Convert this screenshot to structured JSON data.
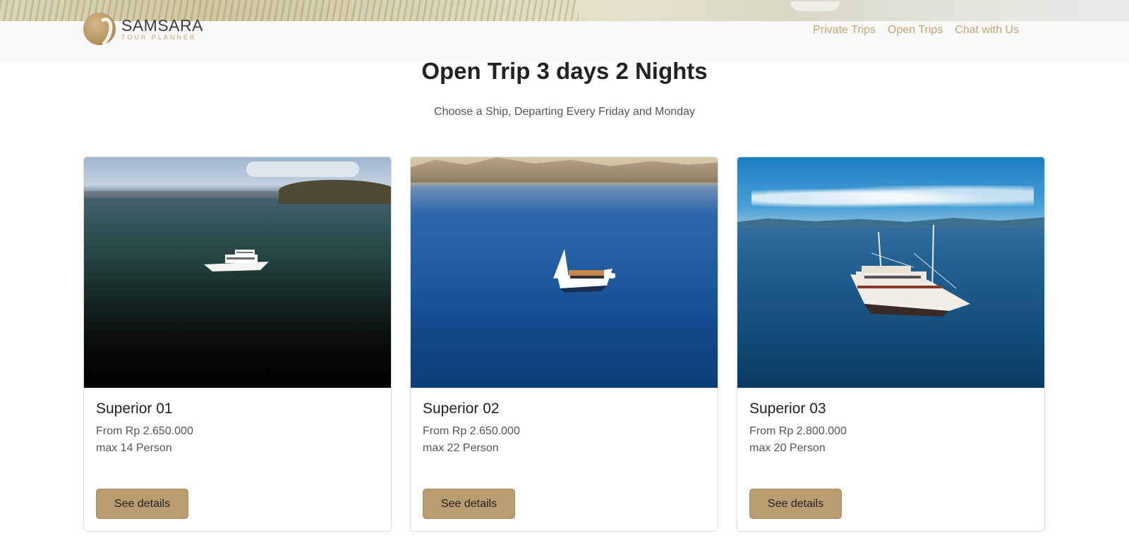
{
  "nav": {
    "brand_name": "SAMSARA",
    "brand_sub": "TOUR PLANNER",
    "links": [
      {
        "label": "Private Trips"
      },
      {
        "label": "Open Trips"
      },
      {
        "label": "Chat with Us"
      }
    ]
  },
  "page": {
    "title": "Open Trip 3 days 2 Nights",
    "subtitle": "Choose a Ship, Departing Every Friday and Monday"
  },
  "cards": [
    {
      "title": "Superior 01",
      "price": "From Rp 2.650.000",
      "capacity": "max 14 Person",
      "button": "See details"
    },
    {
      "title": "Superior 02",
      "price": "From Rp 2.650.000",
      "capacity": "max 22 Person",
      "button": "See details"
    },
    {
      "title": "Superior 03",
      "price": "From Rp 2.800.000",
      "capacity": "max 20 Person",
      "button": "See details"
    }
  ],
  "colors": {
    "accent": "#b89d70",
    "nav_link": "#c0a678",
    "brand_gold": "#c2a66e"
  }
}
